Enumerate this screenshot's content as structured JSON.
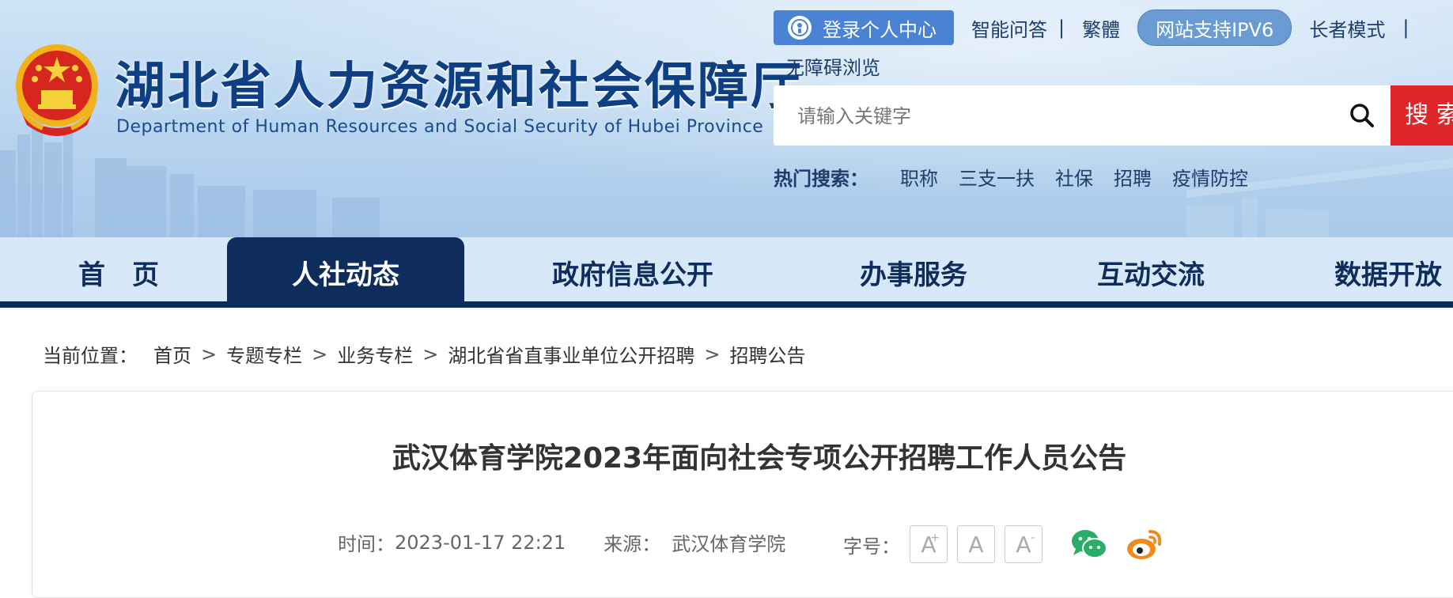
{
  "header": {
    "title": "湖北省人力资源和社会保障厅",
    "subtitle": "Department of Human Resources and Social Security of Hubei Province",
    "login_label": "登录个人中心",
    "links": {
      "qa": "智能问答",
      "sep": "|",
      "traditional": "繁體",
      "ipv6": "网站支持IPV6",
      "elder_mode": "长者模式",
      "accessible": "无障碍浏览"
    },
    "search": {
      "placeholder": "请输入关键字",
      "button": "搜索"
    },
    "hot": {
      "label": "热门搜索：",
      "keywords": [
        "职称",
        "三支一扶",
        "社保",
        "招聘",
        "疫情防控"
      ]
    }
  },
  "nav": {
    "items": [
      "首　页",
      "人社动态",
      "政府信息公开",
      "办事服务",
      "互动交流",
      "数据开放"
    ],
    "active": "人社动态"
  },
  "breadcrumb": {
    "label": "当前位置：",
    "items": [
      "首页",
      "专题专栏",
      "业务专栏",
      "湖北省省直事业单位公开招聘",
      "招聘公告"
    ],
    "sep": ">"
  },
  "article": {
    "title": "武汉体育学院2023年面向社会专项公开招聘工作人员公告",
    "time_label": "时间：",
    "time": "2023-01-17 22:21",
    "source_label": "来源：",
    "source": "武汉体育学院",
    "fontsize_label": "字号：",
    "fontsize_buttons": [
      "A",
      "A",
      "A"
    ],
    "fontsize_marks": [
      "+",
      "",
      "-"
    ]
  },
  "colors": {
    "nav_dark": "#0e2d5c",
    "search_red": "#e0262b",
    "login_blue": "#4a83d3",
    "wechat_green": "#2aae67",
    "weibo_orange": "#f08a1c"
  },
  "icons": {
    "login": "user-circle-icon",
    "search": "magnifier-icon",
    "wechat": "wechat-icon",
    "weibo": "weibo-icon"
  }
}
